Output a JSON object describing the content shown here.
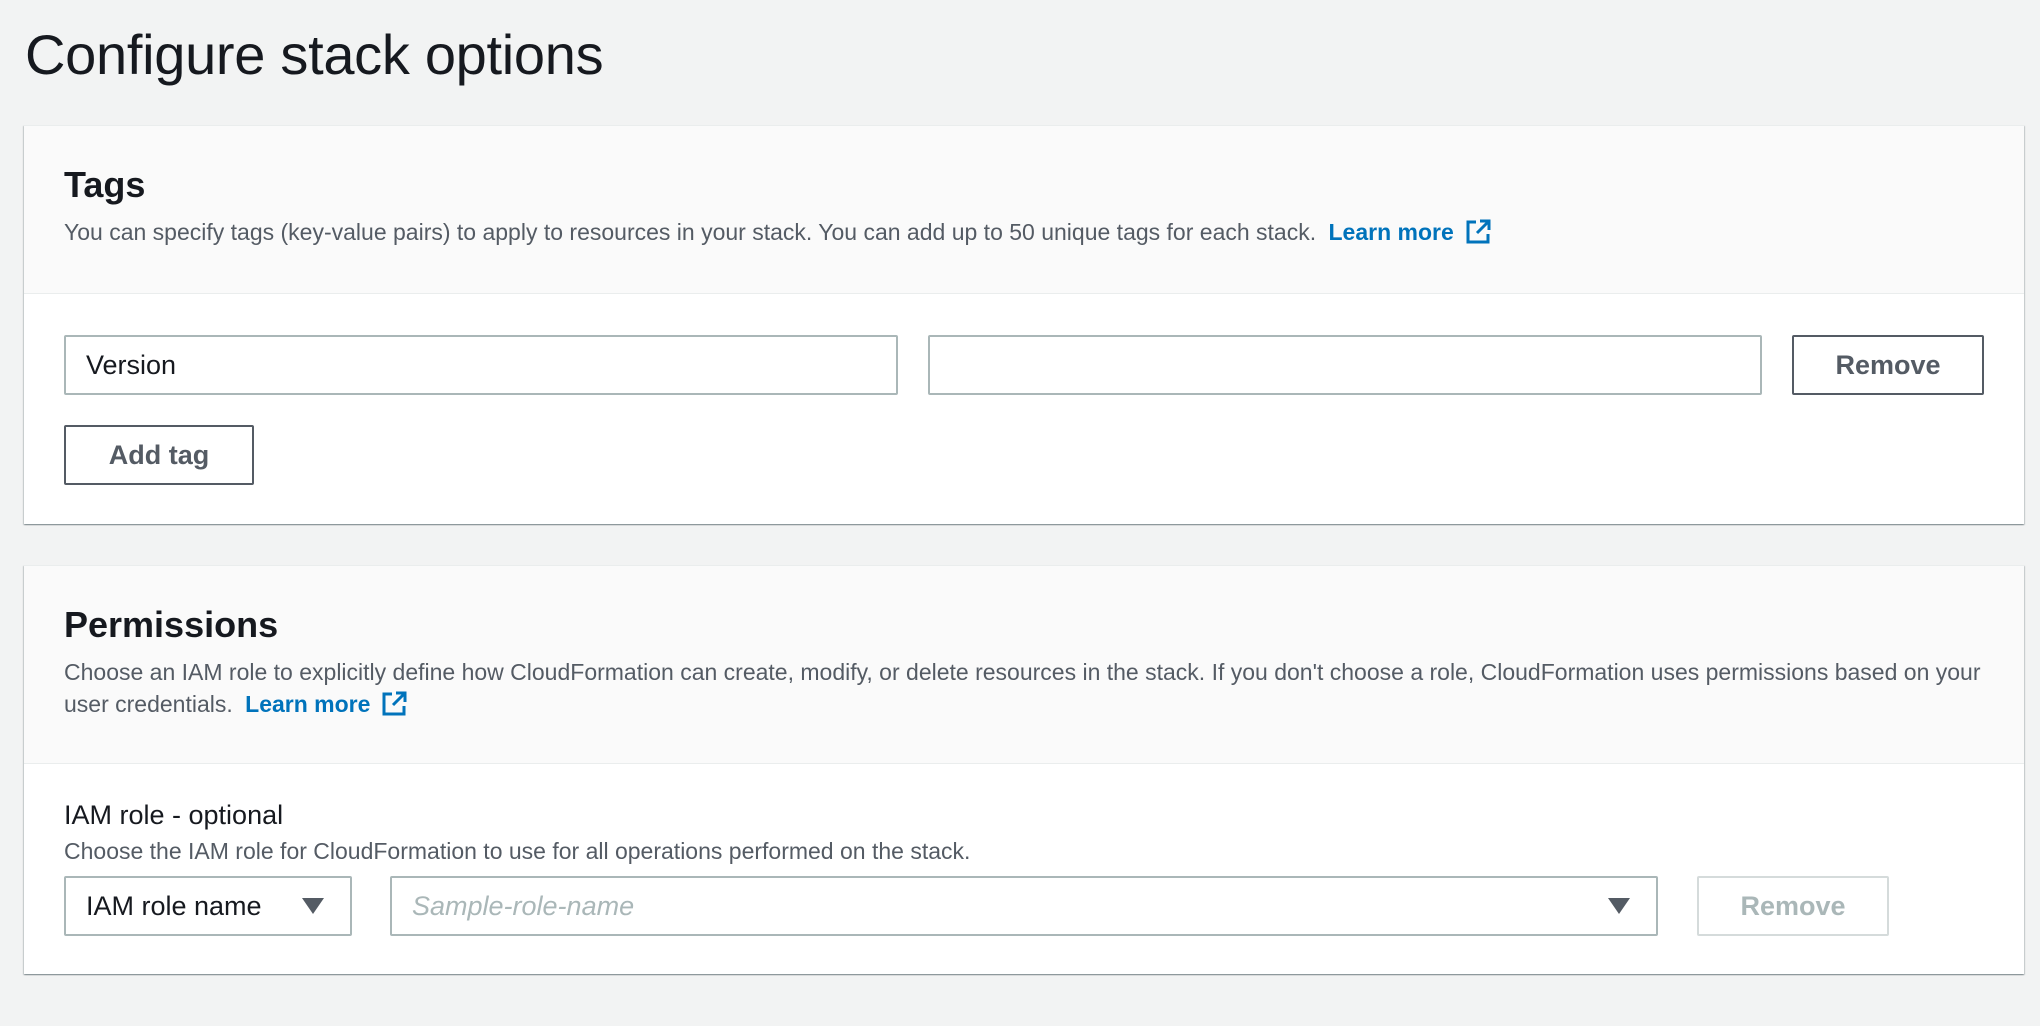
{
  "page": {
    "title": "Configure stack options"
  },
  "tags": {
    "title": "Tags",
    "description": "You can specify tags (key-value pairs) to apply to resources in your stack. You can add up to 50 unique tags for each stack.",
    "learn_more": "Learn more",
    "rows": [
      {
        "key": "Version",
        "value": "",
        "remove_label": "Remove"
      }
    ],
    "add_tag_label": "Add tag"
  },
  "permissions": {
    "title": "Permissions",
    "description": "Choose an IAM role to explicitly define how CloudFormation can create, modify, or delete resources in the stack. If you don't choose a role, CloudFormation uses permissions based on your user credentials.",
    "learn_more": "Learn more",
    "iam_role": {
      "label": "IAM role - optional",
      "description": "Choose the IAM role for CloudFormation to use for all operations performed on the stack.",
      "type_select": "IAM role name",
      "role_placeholder": "Sample-role-name",
      "remove_label": "Remove"
    }
  },
  "colors": {
    "link": "#0073bb",
    "background": "#f2f3f3",
    "border": "#aab7b8",
    "button_text": "#545b64",
    "disabled": "#aab7b8"
  },
  "icons": [
    "external-link-icon",
    "caret-down-icon"
  ]
}
